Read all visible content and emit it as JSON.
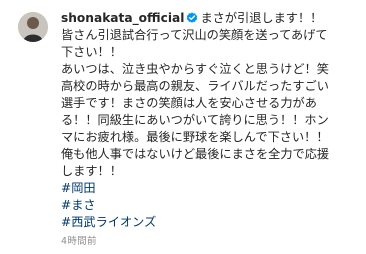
{
  "post": {
    "username": "shonakata_official",
    "verified_icon": "verified-badge-icon",
    "avatar_icon": "user-avatar",
    "accent_color": "#0095f6",
    "hashtag_color": "#00376b",
    "caption_lines": [
      "まさが引退します！！",
      "皆さん引退試合行って沢山の笑顔を送ってあげて",
      "下さい！！",
      "あいつは、泣き虫やからすぐ泣くと思うけど！笑",
      "高校の時から最高の親友、ライバルだったすごい",
      "選手です！まさの笑顔は人を安心させる力があ",
      "る！！同級生にあいつがいて誇りに思う！！ホン",
      "マにお疲れ様。最後に野球を楽しんで下さい！！",
      "俺も他人事ではないけど最後にまさを全力で応援",
      "します！！"
    ],
    "hashtags": [
      "#岡田",
      "#まさ",
      "#西武ライオンズ"
    ],
    "timestamp": "4時間前"
  }
}
